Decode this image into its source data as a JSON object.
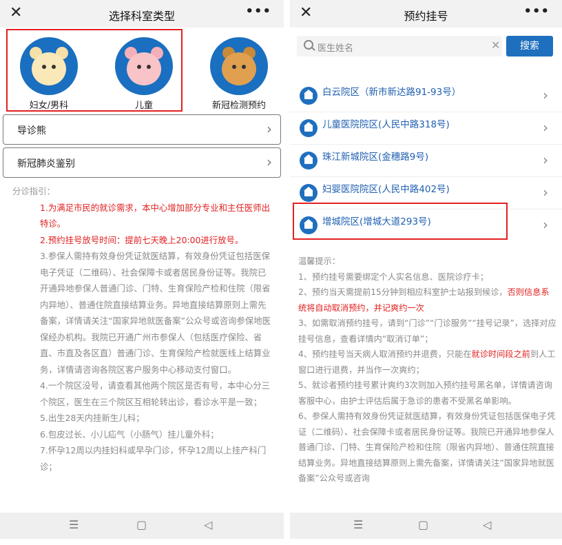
{
  "left": {
    "title": "选择科室类型",
    "depts": [
      {
        "label": "妇女/男科"
      },
      {
        "label": "儿童"
      },
      {
        "label": "新冠检测预约"
      }
    ],
    "menu": [
      "导诊熊",
      "新冠肺炎鉴别"
    ],
    "guide_title": "分诊指引：",
    "guide": [
      "1.为满足市民的就诊需求，本中心增加部分专业和主任医师出特诊。",
      "2.预约挂号放号时间：提前七天晚上20:00进行放号。",
      "3.参保人需持有效身份凭证就医结算，有效身份凭证包括医保电子凭证（二维码）、社会保障卡或者居民身份证等。我院已开通异地参保人普通门诊、门特、生育保险产检和住院（限省内异地）、普通住院直接结算业务。异地直接结算原则上需先备案，详情请关注“国家异地就医备案”公众号或咨询参保地医保经办机构。我院已开通广州市参保人（包括医疗保险、省直、市直及各区直）普通门诊、生育保险产检就医线上结算业务，详情请咨询各院区客户服务中心移动支付窗口。",
      "4.一个院区没号，请查看其他两个院区是否有号，本中心分三个院区，医生在三个院区互相轮转出诊，看诊水平是一致；",
      "5.出生28天内挂新生儿科；",
      "6.包皮过长、小儿疝气（小肠气）挂儿童外科；",
      "7.怀孕12周以内挂妇科或早孕门诊，怀孕12周以上挂产科门诊；"
    ]
  },
  "right": {
    "title": "预约挂号",
    "search_placeholder": "医生姓名",
    "search_button": "搜索",
    "hospitals": [
      "白云院区（新市新达路91-93号）",
      "儿童医院院区(人民中路318号)",
      "珠江新城院区(金穗路9号)",
      "妇婴医院院区(人民中路402号)",
      "增城院区(增城大道293号)"
    ],
    "tips_title": "温馨提示：",
    "tip1": "1、预约挂号需要绑定个人实名信息、医院诊疗卡；",
    "tip2a": "2、预约当天需提前15分钟到相应科室护士站报到候诊，",
    "tip2b": "否则信息系统将自动取消预约，并记爽约一次",
    "tip3": "3、如需取消预约挂号，请到“门诊”“门诊服务”“挂号记录”，选择对应挂号信息，查看详情内“取消订单”；",
    "tip4a": "4、预约挂号当天病人取消预约并退费，只能在",
    "tip4b": "就诊时间段之前",
    "tip4c": "到人工窗口进行退费，并当作一次爽约；",
    "tip5": "5、就诊者预约挂号累计爽约3次则加入预约挂号黑名单，详情请咨询客服中心，由护士评估后属于急诊的患者不受黑名单影响。",
    "tip6": "6、参保人需持有效身份凭证就医结算，有效身份凭证包括医保电子凭证（二维码）、社会保障卡或者居民身份证等。我院已开通异地参保人普通门诊、门特、生育保险产检和住院（限省内异地）、普通住院直接结算业务。异地直接结算原则上需先备案，详情请关注“国家异地就医备案”公众号或咨询"
  },
  "colors": {
    "red": "#e32020",
    "blue": "#1f6fbf"
  }
}
